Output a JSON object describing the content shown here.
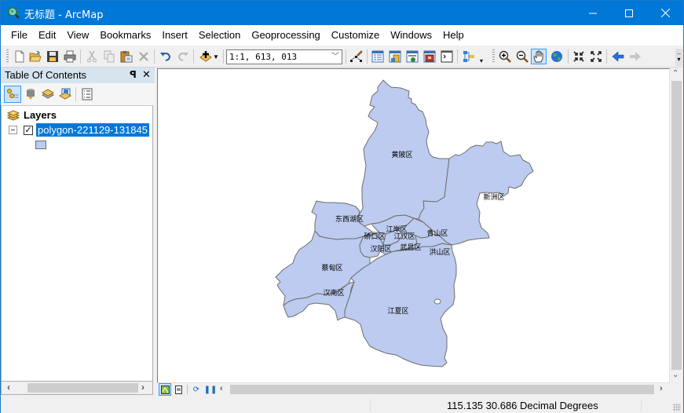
{
  "window": {
    "title": "无标题 - ArcMap",
    "controls": {
      "minimize": "minimize",
      "maximize": "maximize",
      "close": "close"
    }
  },
  "menubar": {
    "items": [
      "File",
      "Edit",
      "View",
      "Bookmarks",
      "Insert",
      "Selection",
      "Geoprocessing",
      "Customize",
      "Windows",
      "Help"
    ]
  },
  "toolbar": {
    "scale": "1:1, 613, 013",
    "tools": [
      {
        "name": "new-document",
        "icon": "new-document-icon"
      },
      {
        "name": "open",
        "icon": "open-folder-icon"
      },
      {
        "name": "save",
        "icon": "save-icon"
      },
      {
        "name": "print",
        "icon": "print-icon"
      },
      {
        "name": "cut",
        "icon": "cut-icon",
        "enabled": false
      },
      {
        "name": "copy",
        "icon": "copy-icon",
        "enabled": false
      },
      {
        "name": "paste",
        "icon": "paste-icon"
      },
      {
        "name": "delete",
        "icon": "delete-icon",
        "enabled": false
      },
      {
        "name": "undo",
        "icon": "undo-icon"
      },
      {
        "name": "redo",
        "icon": "redo-icon",
        "enabled": false
      },
      {
        "name": "add-data",
        "icon": "add-data-icon"
      },
      {
        "name": "editor",
        "icon": "editor-icon"
      },
      {
        "name": "table-of-contents",
        "icon": "toc-window-icon"
      },
      {
        "name": "catalog",
        "icon": "catalog-window-icon"
      },
      {
        "name": "search",
        "icon": "search-window-icon"
      },
      {
        "name": "arctoolbox",
        "icon": "toolbox-icon"
      },
      {
        "name": "python",
        "icon": "python-window-icon"
      },
      {
        "name": "model-builder",
        "icon": "model-builder-icon"
      },
      {
        "name": "zoom-in",
        "icon": "zoom-in-icon"
      },
      {
        "name": "zoom-out",
        "icon": "zoom-out-icon"
      },
      {
        "name": "pan",
        "icon": "pan-hand-icon",
        "active": true
      },
      {
        "name": "full-extent",
        "icon": "globe-icon"
      },
      {
        "name": "fixed-zoom-in",
        "icon": "fixed-zoom-in-icon"
      },
      {
        "name": "fixed-zoom-out",
        "icon": "fixed-zoom-out-icon"
      },
      {
        "name": "back-extent",
        "icon": "arrow-left-icon"
      },
      {
        "name": "forward-extent",
        "icon": "arrow-right-icon",
        "enabled": false
      }
    ]
  },
  "toc": {
    "title": "Table Of Contents",
    "pin_glyph": "ᵖ",
    "close_glyph": "✕",
    "tabs": [
      "list-by-drawing-order",
      "list-by-source",
      "list-by-visibility",
      "list-by-selection",
      "options"
    ],
    "root_label": "Layers",
    "layers": [
      {
        "name": "polygon-221129-131845",
        "checked": true,
        "expanded": true,
        "selected": true,
        "symbol_color": "#bccbef"
      }
    ]
  },
  "map": {
    "fill_color": "#bccbef",
    "outline_color": "#6e6e6e",
    "labels": [
      "黄陂区",
      "新洲区",
      "东西湖区",
      "江岸区",
      "硚口区",
      "江汉区",
      "青山区",
      "汉阳区",
      "武昌区",
      "洪山区",
      "蔡甸区",
      "汉南区",
      "江夏区"
    ],
    "view_buttons": [
      "data-view",
      "layout-view",
      "refresh",
      "pause-drawing"
    ]
  },
  "statusbar": {
    "coordinates": "115.135  30.686 Decimal Degrees"
  }
}
